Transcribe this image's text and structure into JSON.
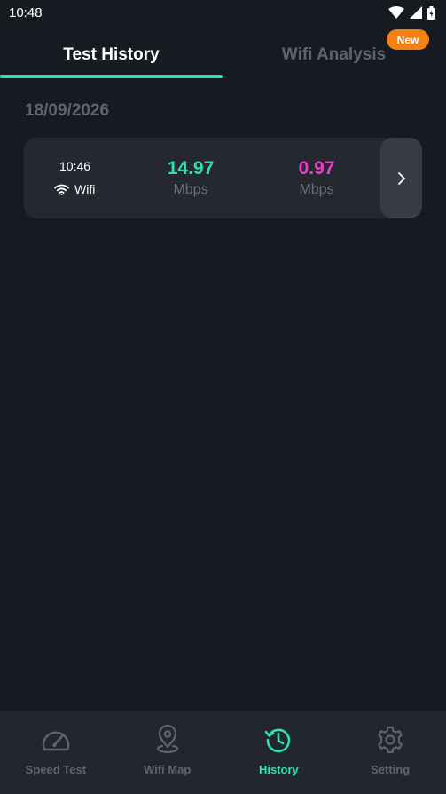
{
  "status_bar": {
    "time": "10:48"
  },
  "tabs": [
    {
      "label": "Test History",
      "active": true
    },
    {
      "label": "Wifi Analysis",
      "active": false,
      "badge": "New"
    }
  ],
  "history": {
    "date": "18/09/2026",
    "entries": [
      {
        "time": "10:46",
        "network": "Wifi",
        "download": {
          "value": "14.97",
          "unit": "Mbps"
        },
        "upload": {
          "value": "0.97",
          "unit": "Mbps"
        }
      }
    ]
  },
  "bottom_nav": [
    {
      "label": "Speed Test",
      "icon": "speedometer-icon",
      "active": false
    },
    {
      "label": "Wifi Map",
      "icon": "map-pin-icon",
      "active": false
    },
    {
      "label": "History",
      "icon": "history-icon",
      "active": true
    },
    {
      "label": "Setting",
      "icon": "gear-icon",
      "active": false
    }
  ],
  "colors": {
    "accent": "#2de0b5",
    "upload": "#ec3fc6",
    "badge": "#f68013",
    "background": "#181a21",
    "card": "#252830"
  }
}
